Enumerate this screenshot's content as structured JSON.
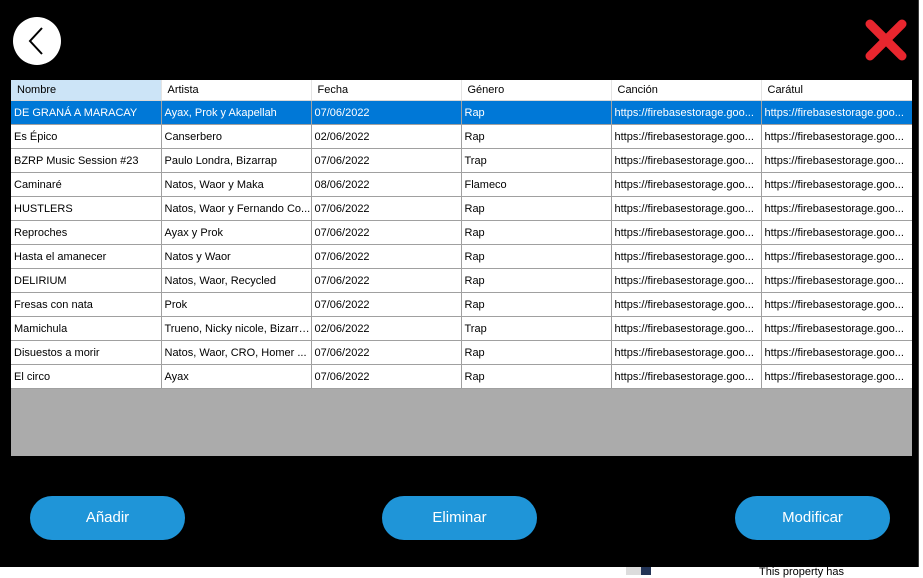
{
  "buttons": {
    "back_icon": "chevron-left-icon",
    "close_icon": "close-x-icon",
    "add_label": "Añadir",
    "delete_label": "Eliminar",
    "modify_label": "Modificar"
  },
  "colors": {
    "window_bg": "#000000",
    "button_bg": "#1f95d8",
    "selection_bg": "#0078d7",
    "close_red": "#e8262e"
  },
  "table": {
    "columns": [
      "Nombre",
      "Artista",
      "Fecha",
      "Género",
      "Canción",
      "Carátul"
    ],
    "rows": [
      [
        "DE GRANÁ A MARACAY",
        "Ayax, Prok y Akapellah",
        "07/06/2022",
        "Rap",
        "https://firebasestorage.goo...",
        "https://firebasestorage.goo..."
      ],
      [
        "Es Épico",
        "Canserbero",
        "02/06/2022",
        "Rap",
        "https://firebasestorage.goo...",
        "https://firebasestorage.goo..."
      ],
      [
        "BZRP Music Session #23",
        "Paulo Londra, Bizarrap",
        "07/06/2022",
        "Trap",
        "https://firebasestorage.goo...",
        "https://firebasestorage.goo..."
      ],
      [
        "Caminaré",
        "Natos, Waor y Maka",
        "08/06/2022",
        "Flameco",
        "https://firebasestorage.goo...",
        "https://firebasestorage.goo..."
      ],
      [
        "HUSTLERS",
        "Natos, Waor y Fernando Co...",
        "07/06/2022",
        "Rap",
        "https://firebasestorage.goo...",
        "https://firebasestorage.goo..."
      ],
      [
        "Reproches",
        "Ayax y Prok",
        "07/06/2022",
        "Rap",
        "https://firebasestorage.goo...",
        "https://firebasestorage.goo..."
      ],
      [
        "Hasta el amanecer",
        "Natos y Waor",
        "07/06/2022",
        "Rap",
        "https://firebasestorage.goo...",
        "https://firebasestorage.goo..."
      ],
      [
        "DELIRIUM",
        "Natos, Waor, Recycled",
        "07/06/2022",
        "Rap",
        "https://firebasestorage.goo...",
        "https://firebasestorage.goo..."
      ],
      [
        "Fresas con nata",
        "Prok",
        "07/06/2022",
        "Rap",
        "https://firebasestorage.goo...",
        "https://firebasestorage.goo..."
      ],
      [
        "Mamichula",
        "Trueno, Nicky nicole, Bizarrap",
        "02/06/2022",
        "Trap",
        "https://firebasestorage.goo...",
        "https://firebasestorage.goo..."
      ],
      [
        "Disuestos a morir",
        "Natos, Waor, CRO, Homer ...",
        "07/06/2022",
        "Rap",
        "https://firebasestorage.goo...",
        "https://firebasestorage.goo..."
      ],
      [
        "El circo",
        "Ayax",
        "07/06/2022",
        "Rap",
        "https://firebasestorage.goo...",
        "https://firebasestorage.goo..."
      ]
    ],
    "selected_row": 0
  },
  "background_text": "This property has"
}
